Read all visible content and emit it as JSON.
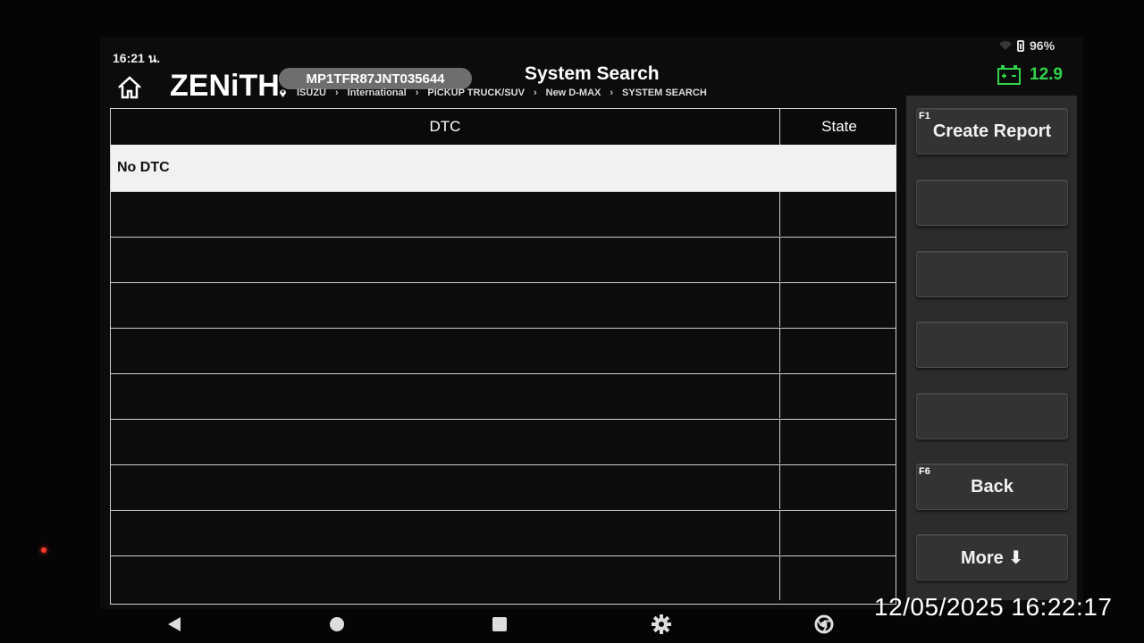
{
  "status_bar": {
    "time": "16:21 น.",
    "battery": "96%"
  },
  "header": {
    "logo": "ZENiTH",
    "vin": "MP1TFR87JNT035644",
    "title": "System Search",
    "breadcrumb": [
      "ISUZU",
      "International",
      "PICKUP TRUCK/SUV",
      "New D-MAX",
      "SYSTEM SEARCH"
    ],
    "voltage": "12.9",
    "voltage_color": "#2fd34a"
  },
  "table": {
    "columns": [
      "DTC",
      "State"
    ],
    "rows": [
      {
        "dtc": "No DTC",
        "state": ""
      }
    ],
    "empty_rows": 9
  },
  "side_panel": {
    "buttons": [
      {
        "fkey": "F1",
        "label": "Create Report"
      },
      {
        "fkey": "",
        "label": ""
      },
      {
        "fkey": "",
        "label": ""
      },
      {
        "fkey": "",
        "label": ""
      },
      {
        "fkey": "",
        "label": ""
      },
      {
        "fkey": "F6",
        "label": "Back"
      },
      {
        "fkey": "",
        "label": "More ⬇"
      }
    ]
  },
  "nav": [
    "back-icon",
    "home-circle-icon",
    "recents-icon",
    "settings-gear-icon",
    "chrome-icon"
  ],
  "timestamp": "12/05/2025 16:22:17"
}
